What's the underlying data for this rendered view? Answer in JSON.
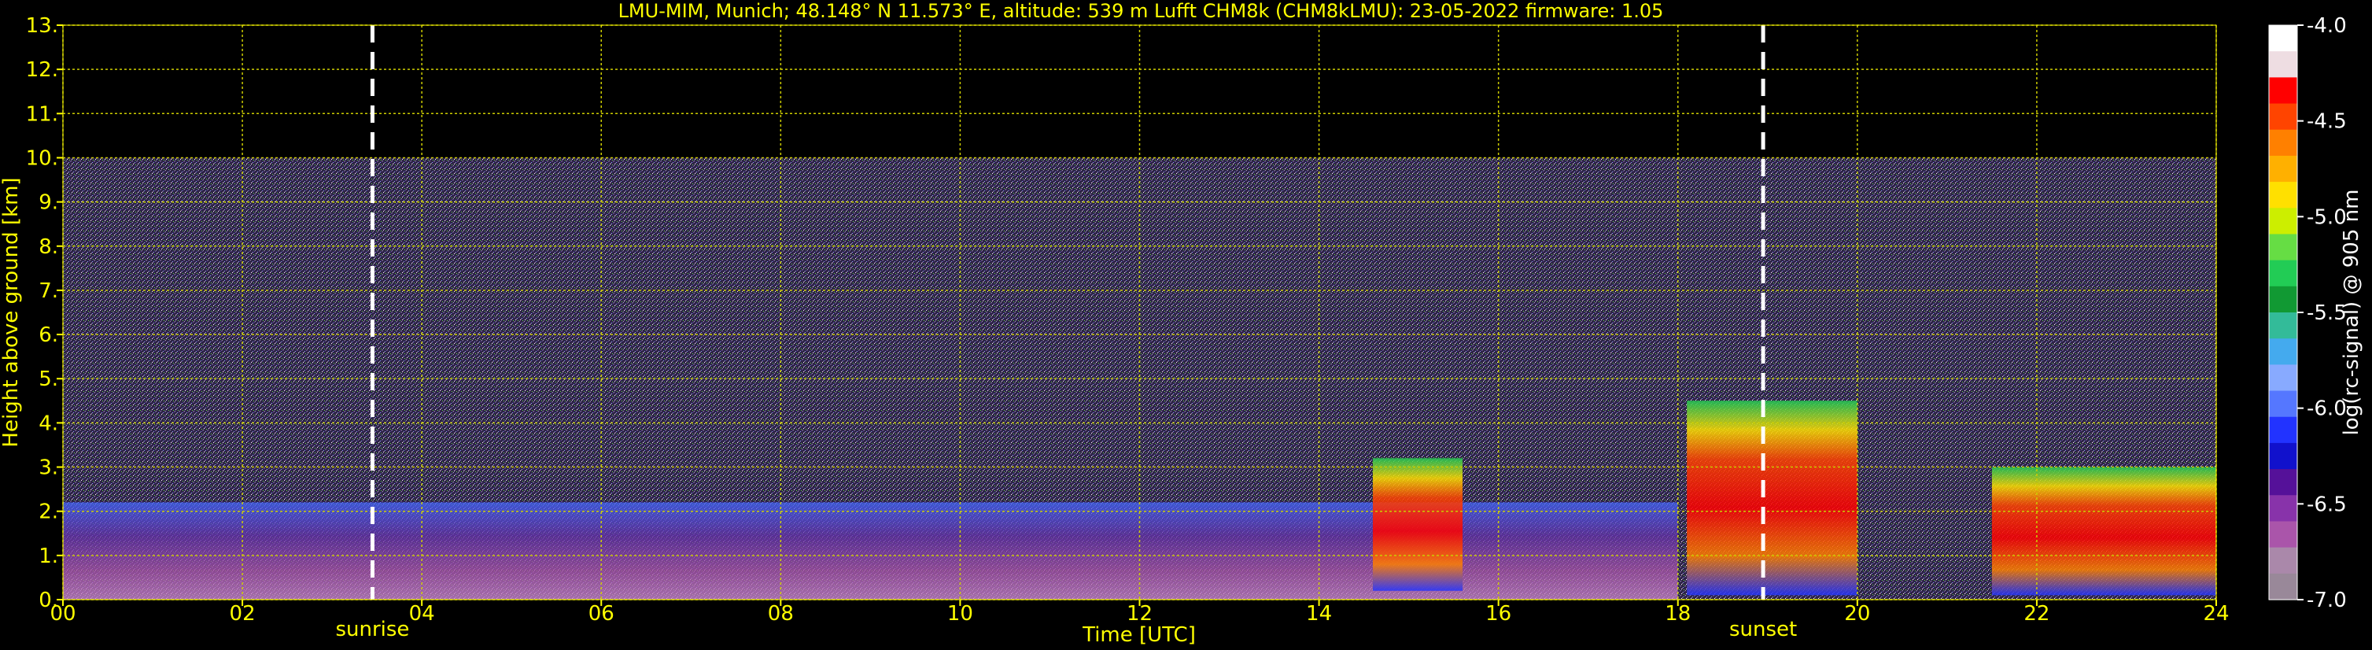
{
  "chart_data": {
    "type": "heatmap",
    "title": "LMU-MIM, Munich; 48.148° N 11.573° E, altitude: 539 m    Lufft CHM8k (CHM8kLMU): 23-05-2022    firmware: 1.05",
    "xlabel": "Time [UTC]",
    "ylabel": "Height above ground [km]",
    "xlim": [
      0,
      24
    ],
    "ylim": [
      0,
      13
    ],
    "x_ticks": [
      "00",
      "02",
      "04",
      "06",
      "08",
      "10",
      "12",
      "14",
      "16",
      "18",
      "20",
      "22",
      "24"
    ],
    "y_ticks": [
      "0.",
      "1.",
      "2.",
      "3.",
      "4.",
      "5.",
      "6.",
      "7.",
      "8.",
      "9.",
      "10.",
      "11.",
      "12.",
      "13."
    ],
    "grid": true,
    "markers": [
      {
        "label": "sunrise",
        "time": 3.45
      },
      {
        "label": "sunset",
        "time": 18.95
      }
    ],
    "colorbar": {
      "label": "log(rc-signal) @ 905 nm",
      "min": -7.0,
      "max": -4.0,
      "tick_labels": [
        "-4.0",
        "-4.5",
        "-5.0",
        "-5.5",
        "-6.0",
        "-6.5",
        "-7.0"
      ],
      "colors": [
        "#ffffff",
        "#eedde2",
        "#ff0000",
        "#ff4400",
        "#ff8000",
        "#ffb000",
        "#ffe000",
        "#ccee00",
        "#66dd44",
        "#22cc55",
        "#119933",
        "#33bb99",
        "#44aaee",
        "#88aaff",
        "#5577ff",
        "#2233ff",
        "#1111cc",
        "#551199",
        "#8833aa",
        "#aa55aa",
        "#aa88aa",
        "#998899"
      ]
    },
    "signal_max_height_km": 10,
    "features": [
      {
        "description_type": "aerosol_layer",
        "time_start": 0,
        "time_end": 18,
        "height_top_km": 1.0
      },
      {
        "description_type": "cloud",
        "time_start": 14.6,
        "time_end": 15.6,
        "height_base_km": 0.2,
        "height_top_km": 3.2
      },
      {
        "description_type": "cloud",
        "time_start": 18.1,
        "time_end": 20.0,
        "height_base_km": 0.1,
        "height_top_km": 4.5
      },
      {
        "description_type": "cloud",
        "time_start": 21.5,
        "time_end": 24,
        "height_base_km": 0.1,
        "height_top_km": 3.0
      }
    ]
  }
}
